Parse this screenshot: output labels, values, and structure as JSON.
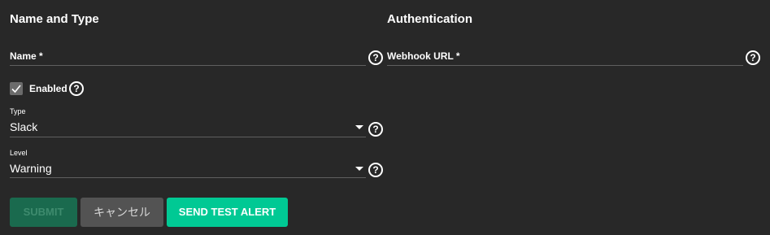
{
  "left_section": {
    "title": "Name and Type",
    "name_field": {
      "label": "Name *",
      "value": ""
    },
    "enabled": {
      "label": "Enabled",
      "checked": true
    },
    "type_select": {
      "label": "Type",
      "value": "Slack"
    },
    "level_select": {
      "label": "Level",
      "value": "Warning"
    }
  },
  "right_section": {
    "title": "Authentication",
    "webhook_field": {
      "label": "Webhook URL *",
      "value": ""
    }
  },
  "icons": {
    "help": "?",
    "checkmark": "check-icon",
    "dropdown": "triangle-down-icon"
  },
  "buttons": {
    "submit": "SUBMIT",
    "cancel": "キャンセル",
    "send_test": "SEND TEST ALERT"
  },
  "colors": {
    "background": "#282828",
    "accent": "#00c994",
    "submit_disabled": "#1a6a4e",
    "cancel": "#535353"
  }
}
